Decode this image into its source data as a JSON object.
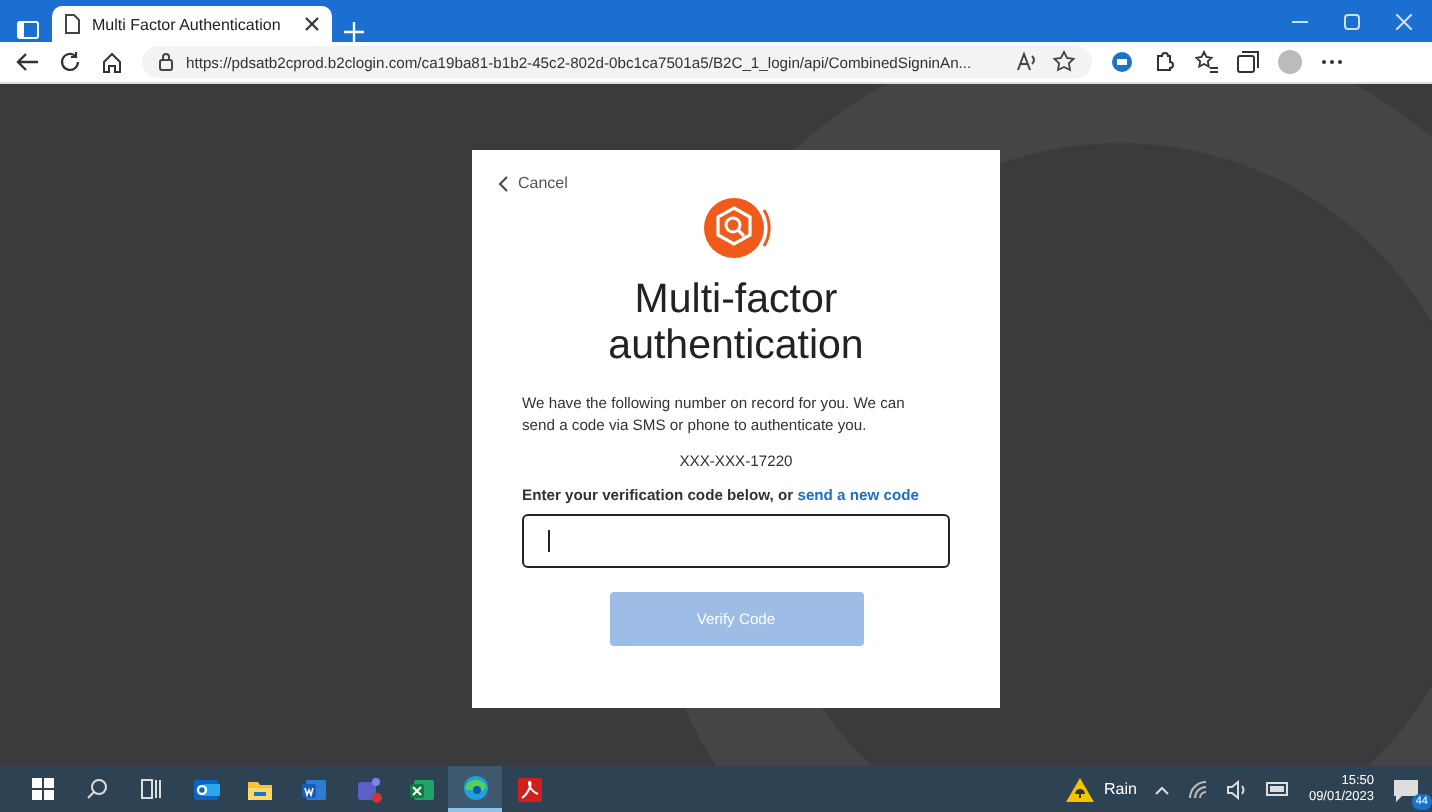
{
  "browser": {
    "tab": {
      "title": "Multi Factor Authentication",
      "selected": true
    },
    "url": "https://pdsatb2cprod.b2clogin.com/ca19ba81-b1b2-45c2-802d-0bc1ca7501a5/B2C_1_login/api/CombinedSigninAn..."
  },
  "card": {
    "cancel": "Cancel",
    "title": "Multi-factor authentication",
    "message": "We have the following number on record for you. We can send a code via SMS or phone to authenticate you.",
    "phone": "XXX-XXX-17220",
    "prompt": "Enter your verification code below, or",
    "resend_link": "send a new code",
    "verify_button": {
      "label": "Verify Code",
      "disabled": true
    }
  },
  "taskbar": {
    "apps": [
      {
        "kind": "outlook",
        "selected": false
      },
      {
        "kind": "explorer",
        "selected": false
      },
      {
        "kind": "word",
        "selected": false
      },
      {
        "kind": "teams",
        "selected": false
      },
      {
        "kind": "excel",
        "selected": false
      },
      {
        "kind": "edge",
        "selected": true
      },
      {
        "kind": "acrobat",
        "selected": false
      }
    ],
    "weather": "Rain",
    "time": "15:50",
    "date": "09/01/2023",
    "notifications": "44"
  }
}
